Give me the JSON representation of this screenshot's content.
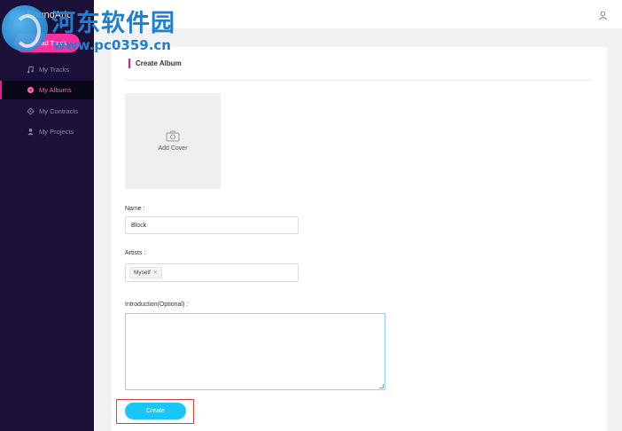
{
  "app": {
    "brand": "SoundArio"
  },
  "sidebar": {
    "upload_label": "Upload Track",
    "items": [
      {
        "label": "My Tracks",
        "icon": "music-note-icon",
        "active": false
      },
      {
        "label": "My Albums",
        "icon": "album-icon",
        "active": true
      },
      {
        "label": "My Contracts",
        "icon": "contract-icon",
        "active": false
      },
      {
        "label": "My Projects",
        "icon": "person-icon",
        "active": false
      }
    ]
  },
  "header": {
    "user_icon": "user-icon"
  },
  "form": {
    "title": "Create Album",
    "cover_label": "Add Cover",
    "name_label": "Name :",
    "name_value": "Block",
    "artists_label": "Artists :",
    "artist_tags": [
      "Myself"
    ],
    "intro_label": "Introduction(Optional) :",
    "intro_value": "",
    "create_label": "Create"
  },
  "watermark": {
    "cn_text": "河东软件园",
    "url": "www.pc0359.cn"
  },
  "colors": {
    "sidebar_bg": "#1b1038",
    "accent_pink": "#e91e8c",
    "upload_button": "#ff2fa0",
    "create_button": "#19c6f5",
    "highlight_box": "#e0403a",
    "watermark_blue": "#1e7fd0"
  }
}
